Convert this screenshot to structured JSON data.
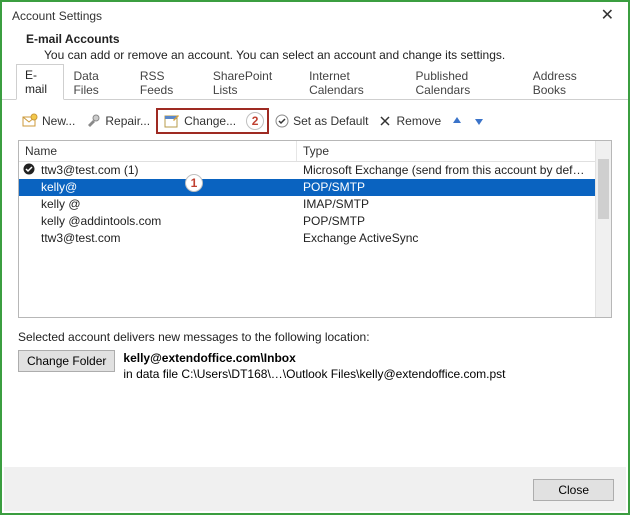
{
  "window": {
    "title": "Account Settings",
    "close_glyph": "✕"
  },
  "header": {
    "title": "E-mail Accounts",
    "subtitle": "You can add or remove an account. You can select an account and change its settings."
  },
  "tabs": [
    {
      "label": "E-mail",
      "active": true
    },
    {
      "label": "Data Files"
    },
    {
      "label": "RSS Feeds"
    },
    {
      "label": "SharePoint Lists"
    },
    {
      "label": "Internet Calendars"
    },
    {
      "label": "Published Calendars"
    },
    {
      "label": "Address Books"
    }
  ],
  "toolbar": {
    "new_label": "New...",
    "repair_label": "Repair...",
    "change_label": "Change...",
    "set_default_label": "Set as Default",
    "remove_label": "Remove"
  },
  "columns": {
    "name": "Name",
    "type": "Type"
  },
  "accounts": [
    {
      "name": "ttw3@test.com (1)",
      "type": "Microsoft Exchange (send from this account by def…",
      "default": true
    },
    {
      "name": "kelly@",
      "type": "POP/SMTP",
      "selected": true
    },
    {
      "name": "kelly          @",
      "type": "IMAP/SMTP"
    },
    {
      "name": "kelly       @addintools.com",
      "type": "POP/SMTP"
    },
    {
      "name": "ttw3@test.com",
      "type": "Exchange ActiveSync"
    }
  ],
  "annotations": {
    "row": "1",
    "change": "2",
    "color": "#9e2a22"
  },
  "delivery": {
    "intro": "Selected account delivers new messages to the following location:",
    "button": "Change Folder",
    "location_bold": "kelly@extendoffice.com\\Inbox",
    "location_sub": "in data file C:\\Users\\DT168\\…\\Outlook Files\\kelly@extendoffice.com.pst"
  },
  "footer": {
    "close": "Close"
  }
}
